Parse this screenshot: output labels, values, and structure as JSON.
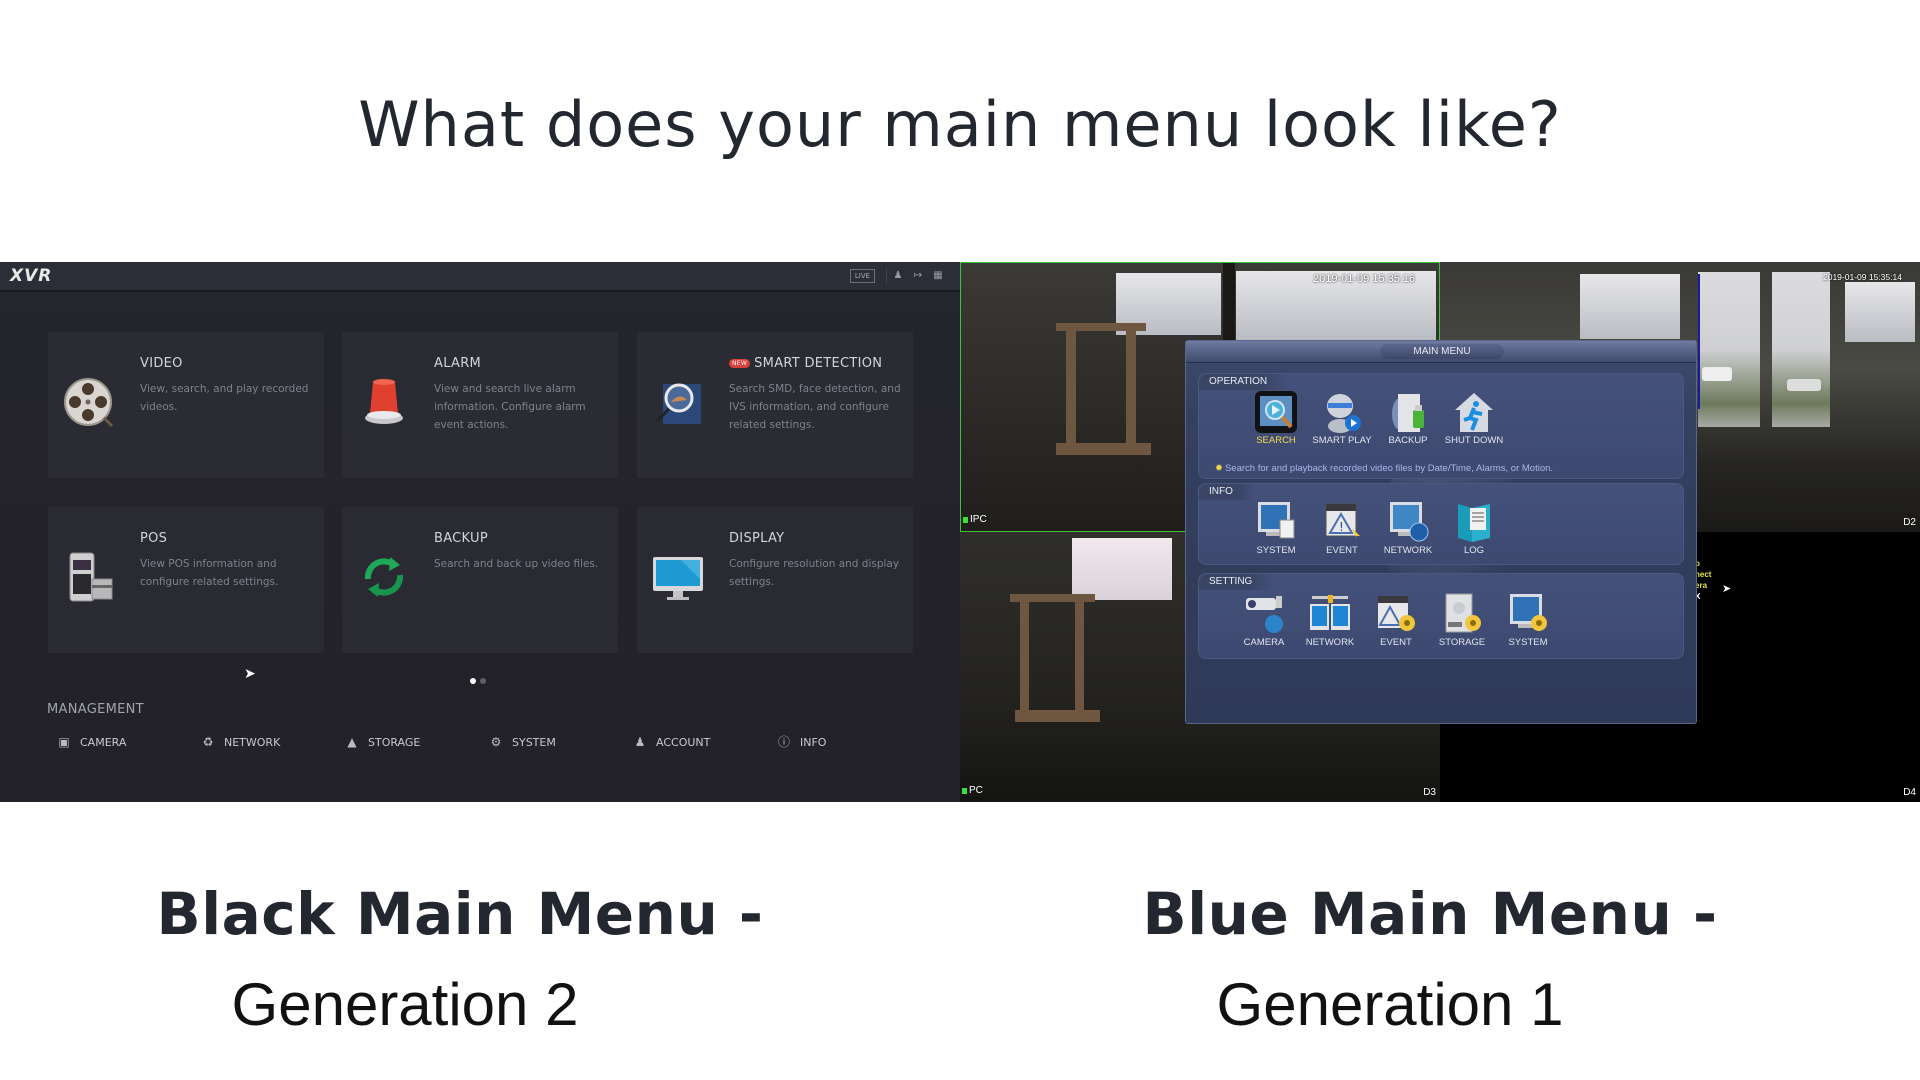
{
  "headline": "What does your main menu look like?",
  "captions": {
    "left": {
      "line1": "Black Main Menu -",
      "line2": "Generation 2"
    },
    "right": {
      "line1": "Blue Main Menu -",
      "line2": "Generation 1"
    }
  },
  "black_menu": {
    "logo": "XVR",
    "topbar": {
      "live_label": "LIVE",
      "user_icon": "user-icon",
      "logout_icon": "logout-icon",
      "layout_icon": "layout-icon"
    },
    "cards": [
      {
        "title": "VIDEO",
        "desc": "View, search, and play recorded videos.",
        "icon": "film-reel-icon",
        "badge": ""
      },
      {
        "title": "ALARM",
        "desc": "View and search live alarm information. Configure alarm event actions.",
        "icon": "alarm-siren-icon",
        "badge": ""
      },
      {
        "title": "SMART DETECTION",
        "desc": "Search SMD, face detection, and IVS information, and configure related settings.",
        "icon": "magnifier-icon",
        "badge": "NEW"
      },
      {
        "title": "POS",
        "desc": "View POS information and configure related settings.",
        "icon": "pos-terminal-icon",
        "badge": ""
      },
      {
        "title": "BACKUP",
        "desc": "Search and back up video files.",
        "icon": "sync-arrows-icon",
        "badge": ""
      },
      {
        "title": "DISPLAY",
        "desc": "Configure resolution and display settings.",
        "icon": "monitor-icon",
        "badge": ""
      }
    ],
    "pager": {
      "pages": 2,
      "current": 1
    },
    "management": {
      "title": "MANAGEMENT",
      "items": [
        {
          "label": "CAMERA",
          "icon": "camera-icon"
        },
        {
          "label": "NETWORK",
          "icon": "globe-icon"
        },
        {
          "label": "STORAGE",
          "icon": "hdd-icon"
        },
        {
          "label": "SYSTEM",
          "icon": "gears-icon"
        },
        {
          "label": "ACCOUNT",
          "icon": "user-gear-icon"
        },
        {
          "label": "INFO",
          "icon": "info-icon"
        }
      ]
    }
  },
  "blue_menu": {
    "cameras": [
      {
        "label": "IPC",
        "id": "",
        "timestamp": "2019-01-09 15:35:16"
      },
      {
        "label": "",
        "id": "D2",
        "timestamp": "2019-01-09 15:35:14"
      },
      {
        "label": "PC",
        "id": "D3",
        "timestamp": ""
      },
      {
        "label": "",
        "id": "D4",
        "timestamp": "",
        "overlay_text": [
          "o",
          "nect",
          "era",
          "X"
        ]
      }
    ],
    "title": "MAIN MENU",
    "sections": [
      {
        "name": "OPERATION",
        "items": [
          {
            "label": "SEARCH",
            "icon": "search-film-icon",
            "active": true
          },
          {
            "label": "SMART PLAY",
            "icon": "robot-play-icon",
            "active": false
          },
          {
            "label": "BACKUP",
            "icon": "usb-backup-icon",
            "active": false
          },
          {
            "label": "SHUT DOWN",
            "icon": "exit-house-icon",
            "active": false
          }
        ],
        "hint": "Search for and playback recorded video files by Date/Time, Alarms, or Motion."
      },
      {
        "name": "INFO",
        "items": [
          {
            "label": "SYSTEM",
            "icon": "monitor-doc-icon"
          },
          {
            "label": "EVENT",
            "icon": "warning-window-icon"
          },
          {
            "label": "NETWORK",
            "icon": "monitor-globe-icon"
          },
          {
            "label": "LOG",
            "icon": "log-book-icon"
          }
        ]
      },
      {
        "name": "SETTING",
        "items": [
          {
            "label": "CAMERA",
            "icon": "camera-globe-icon"
          },
          {
            "label": "NETWORK",
            "icon": "network-monitors-icon"
          },
          {
            "label": "EVENT",
            "icon": "event-gear-icon"
          },
          {
            "label": "STORAGE",
            "icon": "storage-gear-icon"
          },
          {
            "label": "SYSTEM",
            "icon": "system-gear-icon"
          }
        ]
      }
    ]
  },
  "colors": {
    "text_dark": "#23272f",
    "black_panel_bg": "#24262d",
    "blue_menu_bg": "#34405f",
    "active_label": "#f0dc55",
    "hint_text": "#a9b6ea",
    "camera_border": "#3ec23e"
  }
}
